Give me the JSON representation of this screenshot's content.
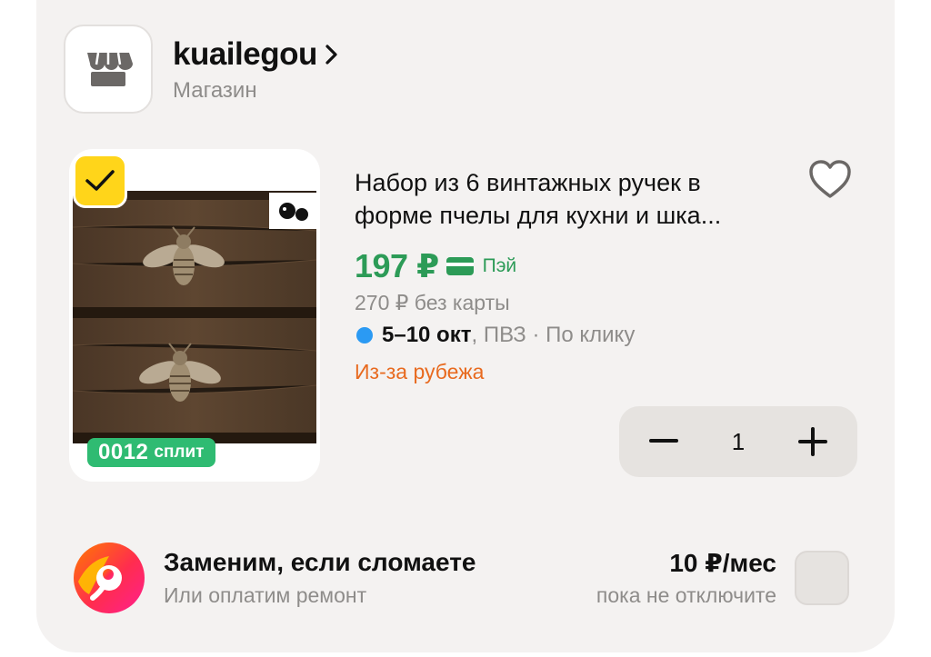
{
  "store": {
    "name": "kuailegou",
    "type": "Магазин",
    "logo_icon": "storefront-icon"
  },
  "product": {
    "selected": true,
    "image_alt": "bee drawer knobs on wooden chest",
    "split_badge_number": "0012",
    "split_badge_word": "сплит",
    "title_line1": "Набор из 6 винтажных ручек в",
    "title_line2": "форме пчелы для кухни и шка...",
    "price": "197 ₽",
    "pay_label": "Пэй",
    "old_price": "270 ₽ без карты",
    "delivery_date": "5–10 окт",
    "delivery_rest": ", ПВЗ · По клику",
    "origin": "Из-за рубежа",
    "quantity": "1"
  },
  "warranty": {
    "title": "Заменим, если сломаете",
    "subtitle": "Или оплатим ремонт",
    "price": "10 ₽/мес",
    "note": "пока не отключите",
    "checked": false
  },
  "colors": {
    "price_green": "#2c9b57",
    "origin_orange": "#e86a1f",
    "check_yellow": "#ffd51a",
    "split_green": "#2fbb72",
    "dot_blue": "#2b9af3"
  }
}
